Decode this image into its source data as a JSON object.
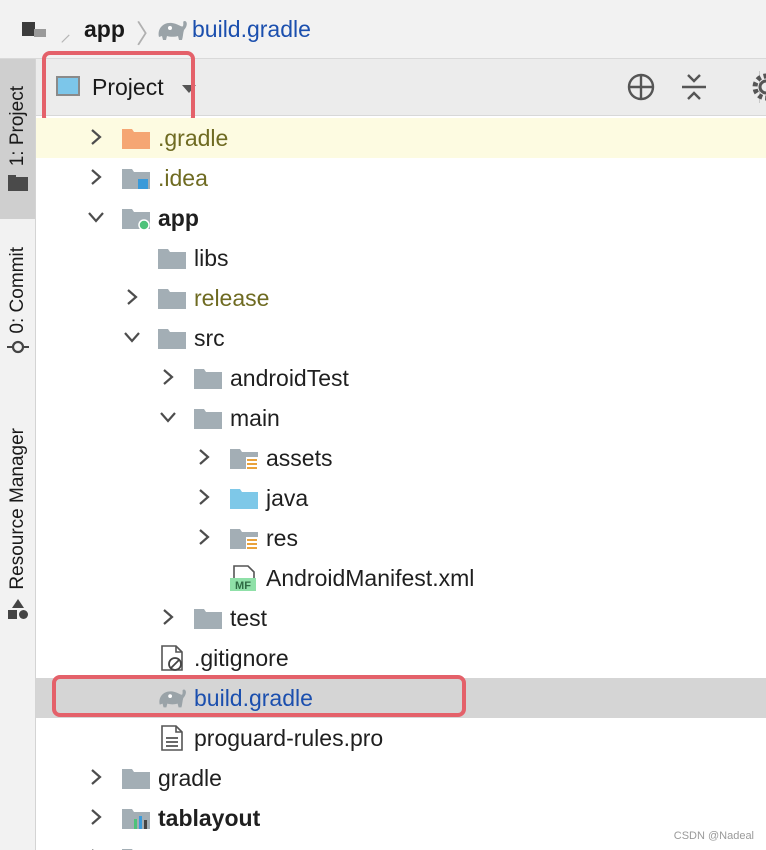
{
  "breadcrumb": {
    "module": "app",
    "file": "build.gradle"
  },
  "tool_stripe": {
    "project_tab": "1: Project",
    "commit_tab": "0: Commit",
    "resource_tab": "Resource Manager"
  },
  "project_panel": {
    "view_name": "Project",
    "toolbar_icons": [
      "locate-icon",
      "collapse-all-icon",
      "gear-icon"
    ]
  },
  "tree": {
    "gradle_dir": ".gradle",
    "idea_dir": ".idea",
    "app_dir": "app",
    "libs_dir": "libs",
    "release_dir": "release",
    "src_dir": "src",
    "android_test_dir": "androidTest",
    "main_dir": "main",
    "assets_dir": "assets",
    "java_dir": "java",
    "res_dir": "res",
    "manifest_file": "AndroidManifest.xml",
    "manifest_badge": "MF",
    "test_dir": "test",
    "gitignore_file": ".gitignore",
    "build_gradle_file": "build.gradle",
    "proguard_file": "proguard-rules.pro",
    "gradle_root_dir": "gradle",
    "tablayout_module": "tablayout"
  },
  "watermark": "CSDN @Nadeal",
  "colors": {
    "highlight_border": "#e4616a",
    "selected_row": "#d5d5d5",
    "ignored_text": "#6f6b22",
    "file_link": "#1b4fae",
    "source_folder": "#7ec8e8",
    "folder": "#a3aeb5"
  }
}
